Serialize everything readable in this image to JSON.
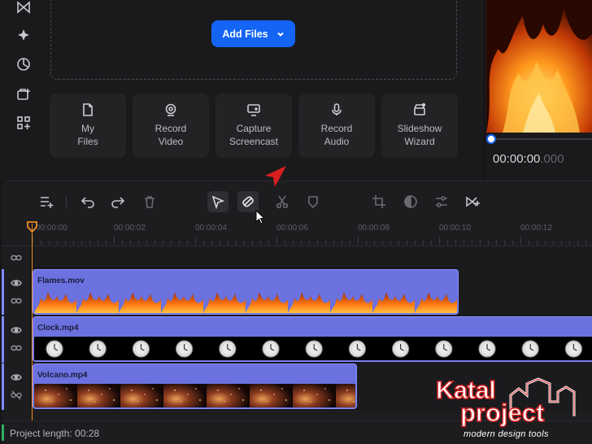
{
  "media": {
    "add_files_label": "Add Files",
    "actions": [
      {
        "label": "My\nFiles",
        "icon": "file-icon"
      },
      {
        "label": "Record\nVideo",
        "icon": "webcam-icon"
      },
      {
        "label": "Capture\nScreencast",
        "icon": "monitor-icon"
      },
      {
        "label": "Record\nAudio",
        "icon": "microphone-icon"
      },
      {
        "label": "Slideshow\nWizard",
        "icon": "clapperboard-icon"
      }
    ]
  },
  "preview": {
    "timecode_main": "00:00:00",
    "timecode_ms": ".000"
  },
  "timeline": {
    "ruler_ticks": [
      "00:00:00",
      "00:00:02",
      "00:00:04",
      "00:00:06",
      "00:00:08",
      "00:00:10",
      "00:00:12"
    ],
    "tracks": [
      {
        "clip": "Flames.mov"
      },
      {
        "clip": "Clock.mp4"
      },
      {
        "clip": "Volcano.mp4"
      }
    ]
  },
  "status": {
    "project_length": "Project length: 00:28"
  },
  "watermark": {
    "line1": "Katal",
    "line2": "project",
    "tagline": "modern design tools"
  },
  "colors": {
    "accent_blue": "#1565f5",
    "clip_purple": "#6b72e0",
    "playhead_orange": "#f08a24",
    "arrow_red": "#d81e1e"
  }
}
